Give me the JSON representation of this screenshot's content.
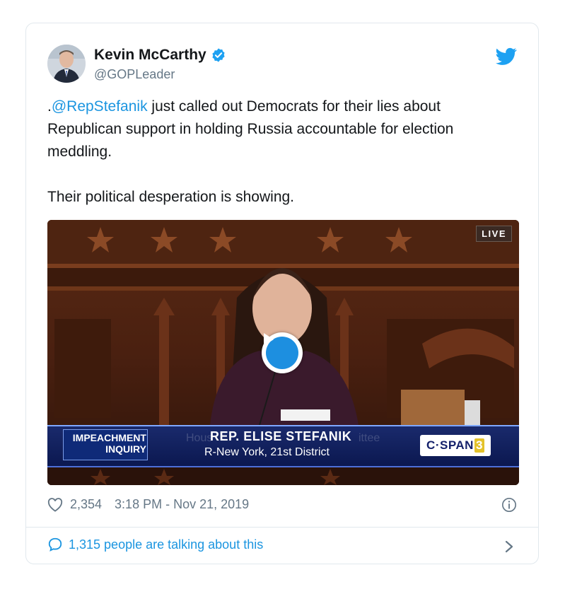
{
  "tweet": {
    "author_name": "Kevin McCarthy",
    "handle": "@GOPLeader",
    "mention": "@RepStefanik",
    "text_prefix": ".",
    "text_rest": " just called out Democrats for their lies about Republican support in holding Russia accountable for election meddling.",
    "text_para2": "Their political desperation is showing."
  },
  "video": {
    "live_label": "LIVE",
    "lower_third_left": "IMPEACHMENT\nINQUIRY",
    "ghost_left": "Hous",
    "ghost_right": "ittee",
    "speaker_name": "REP. ELISE STEFANIK",
    "speaker_district": "R-New York, 21st District",
    "network_label_main": "C·SPAN",
    "network_label_num": "3"
  },
  "meta": {
    "likes": "2,354",
    "timestamp": "3:18 PM - Nov 21, 2019"
  },
  "footer": {
    "talking_label": "1,315 people are talking about this"
  },
  "colors": {
    "accent": "#1b95e0",
    "text": "#14171a",
    "muted": "#657786",
    "border": "#e1e8ed"
  },
  "icons": [
    "verified-badge-icon",
    "twitter-bird-icon",
    "play-icon",
    "heart-icon",
    "info-icon",
    "speech-bubble-icon",
    "chevron-right-icon"
  ]
}
